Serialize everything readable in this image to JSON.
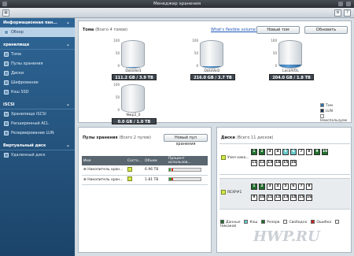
{
  "window": {
    "title": "Менеджер хранения"
  },
  "sidebar": {
    "sections": [
      {
        "label": "Информационная пан...",
        "items": [
          {
            "label": "Обзор",
            "active": true
          }
        ]
      },
      {
        "label": "хранилище",
        "items": [
          {
            "label": "Тома"
          },
          {
            "label": "Пулы хранения"
          },
          {
            "label": "Диски"
          },
          {
            "label": "Шифрование"
          },
          {
            "label": "Кэш SSD"
          }
        ]
      },
      {
        "label": "iSCSI",
        "items": [
          {
            "label": "Хранилище iSCSI"
          },
          {
            "label": "Расширенный ACL"
          },
          {
            "label": "Резервирование LUN"
          }
        ]
      },
      {
        "label": "Виртуальный диск",
        "items": [
          {
            "label": "Удаленный диск"
          }
        ]
      }
    ]
  },
  "volumes_panel": {
    "title": "Тома",
    "subtitle": "(Всего 4 томов)",
    "link": "What's flexible volume?",
    "new_button": "Новый том",
    "refresh_button": "Обновить",
    "scale": [
      "100",
      "50",
      "0"
    ],
    "volumes": [
      {
        "name": "DataVol1",
        "capacity": "111.2 GB / 3.9 TB",
        "used": 0.03
      },
      {
        "name": "DataVol2",
        "capacity": "216.0 GB / 3.7 TB",
        "used": 0.06
      },
      {
        "name": "LocalVOL",
        "capacity": "204.0 GB / 1.8 TB",
        "used": 0.11
      },
      {
        "name": "Nwp2_0",
        "capacity": "0.0 GB / 1.0 TB",
        "used": 0.0
      }
    ],
    "legend": [
      {
        "label": "Том",
        "color": "#2e6ea8"
      },
      {
        "label": "LUN",
        "color": "#1a2e46"
      },
      {
        "label": "Неиспользуем",
        "color": "#ffffff"
      }
    ]
  },
  "pools_panel": {
    "title": "Пулы хранения",
    "subtitle": "(Всего 2 пулов)",
    "new_button": "Новый пул хранения",
    "columns": [
      "Имя",
      "Состо...",
      "Объем",
      "Процент использов..."
    ],
    "rows": [
      {
        "name": "Накопитель хран...",
        "size": "6.96 TB",
        "used": 0.04
      },
      {
        "name": "Накопитель хран...",
        "size": "1.81 TB",
        "used": 0.12
      }
    ]
  },
  "disks_panel": {
    "title": "Диски",
    "subtitle": "(Всего 11 дисков)",
    "groups": [
      {
        "name": "Узел нако...",
        "row1": [
          "1",
          "2",
          "3",
          "4",
          "5",
          "6",
          "7",
          "8",
          "9",
          "10"
        ],
        "row2": [
          "11",
          "12",
          "13",
          "14",
          "15",
          "16"
        ]
      },
      {
        "name": "REXP#1",
        "row1": [
          "1",
          "2",
          "3",
          "4",
          "5",
          "6",
          "7",
          "8"
        ],
        "row2": [
          "9",
          "10",
          "11",
          "12",
          "13",
          "14",
          "15",
          "16"
        ]
      }
    ],
    "legend": [
      {
        "label": "Данные",
        "color": "#1f6f2b"
      },
      {
        "label": "Кэш",
        "color": "#69c9c9"
      },
      {
        "label": "Резерв",
        "color": "#1f6f2b"
      },
      {
        "label": "Свободно",
        "color": "#ffffff"
      },
      {
        "label": "Ошибка",
        "color": "#d02020"
      },
      {
        "label": "Никакой",
        "color": "#ffffff"
      }
    ]
  },
  "watermark": "HWP.RU"
}
